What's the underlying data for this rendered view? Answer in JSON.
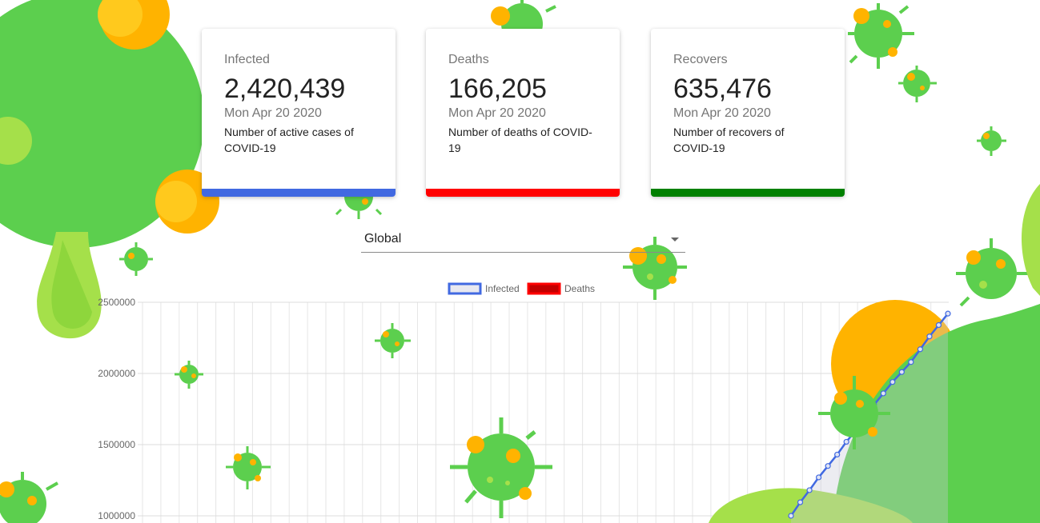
{
  "cards": [
    {
      "title": "Infected",
      "value": "2,420,439",
      "date": "Mon Apr 20 2020",
      "description": "Number of active cases of COVID-19",
      "color": "#4169e1"
    },
    {
      "title": "Deaths",
      "value": "166,205",
      "date": "Mon Apr 20 2020",
      "description": "Number of deaths of COVID-19",
      "color": "#ff0000"
    },
    {
      "title": "Recovers",
      "value": "635,476",
      "date": "Mon Apr 20 2020",
      "description": "Number of recovers of COVID-19",
      "color": "#008000"
    }
  ],
  "region_select": {
    "value": "Global"
  },
  "colors": {
    "virus_green": "#5ccf4e",
    "virus_orange": "#ffb300",
    "blob_lime": "#a5e04a"
  },
  "chart_data": {
    "type": "line",
    "legend": [
      "Infected",
      "Deaths"
    ],
    "legend_placement": "top-center",
    "y_ticks": [
      "2500000",
      "2000000",
      "1500000",
      "1000000"
    ],
    "ylim_visible": [
      1000000,
      2500000
    ],
    "grid": true,
    "series": [
      {
        "name": "Infected",
        "color": "#4169e1",
        "values": [
          1000000,
          1095000,
          1180000,
          1270000,
          1350000,
          1430000,
          1520000,
          1600000,
          1690000,
          1780000,
          1860000,
          1940000,
          2010000,
          2080000,
          2170000,
          2260000,
          2340000,
          2420439
        ]
      },
      {
        "name": "Deaths",
        "color": "#ff0000",
        "values": []
      }
    ]
  }
}
